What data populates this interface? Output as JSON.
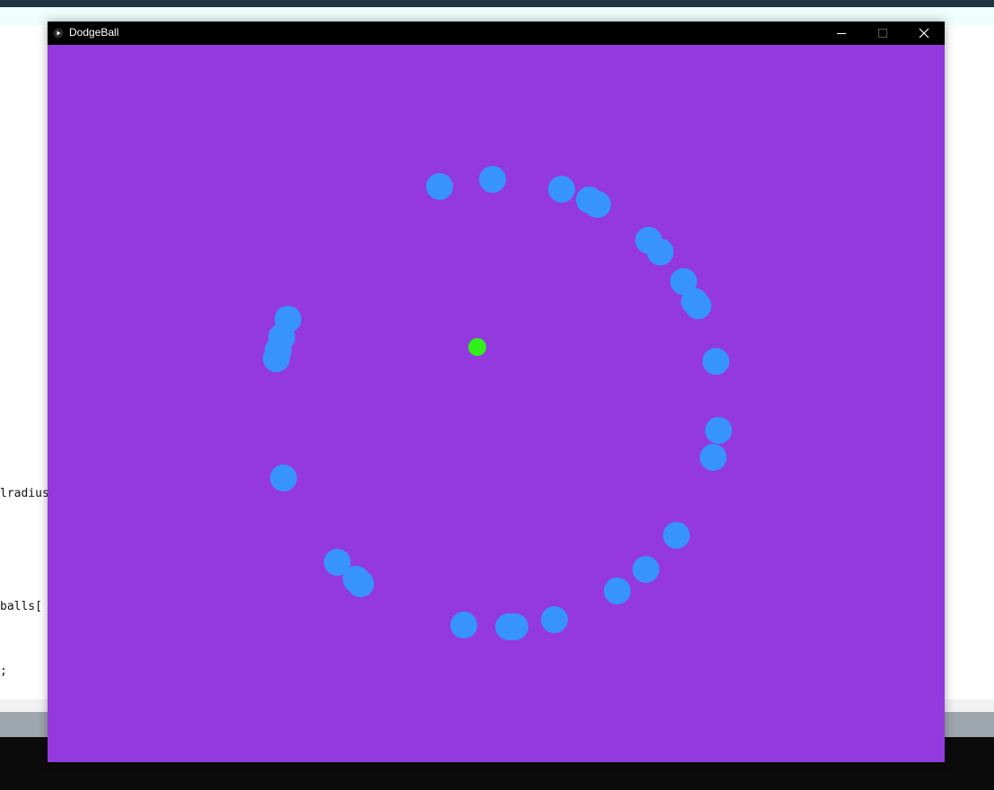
{
  "editor": {
    "code_fragments": [
      "lradius",
      "balls[",
      ";"
    ]
  },
  "window": {
    "title": "DodgeBall",
    "app_icon": "play-icon",
    "controls": [
      "minimize-icon",
      "maximize-icon",
      "close-icon"
    ]
  },
  "game": {
    "background_color": "#9339de",
    "ball_color": "#3794fa",
    "player_color": "#30ef1b",
    "ball_count": 30
  },
  "colors": {
    "titlebar": "#000000",
    "title_text": "#ffffff",
    "ide_topbar": "#1f3442",
    "ide_statusbar": "#9ea6ae"
  }
}
